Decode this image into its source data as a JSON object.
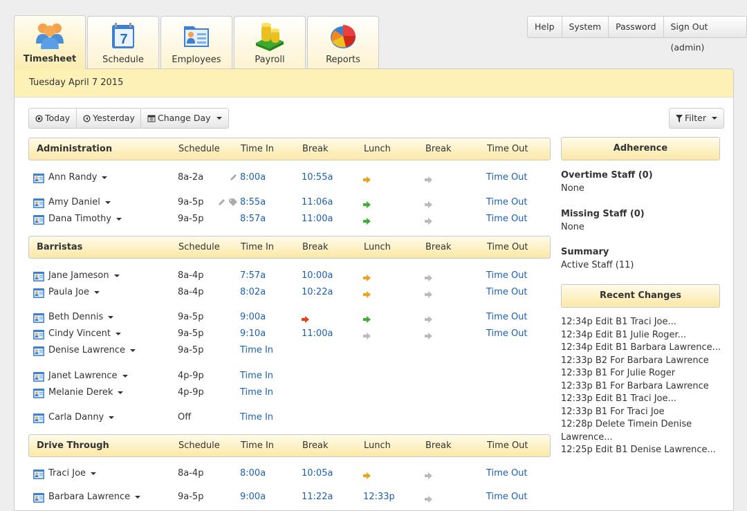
{
  "tabs": [
    {
      "label": "Timesheet",
      "icon": "people-icon",
      "active": true
    },
    {
      "label": "Schedule",
      "icon": "calendar-icon",
      "active": false
    },
    {
      "label": "Employees",
      "icon": "employee-card-icon",
      "active": false
    },
    {
      "label": "Payroll",
      "icon": "coins-icon",
      "active": false
    },
    {
      "label": "Reports",
      "icon": "pie-chart-icon",
      "active": false
    }
  ],
  "top_buttons": [
    "Help",
    "System",
    "Password",
    "Sign Out (admin)"
  ],
  "date": "Tuesday April 7 2015",
  "toolbar": {
    "today": "Today",
    "yesterday": "Yesterday",
    "change_day": "Change Day",
    "filter": "Filter"
  },
  "columns": {
    "schedule": "Schedule",
    "time_in": "Time In",
    "break1": "Break",
    "lunch": "Lunch",
    "break2": "Break",
    "time_out": "Time Out"
  },
  "groups": [
    {
      "name": "Administration",
      "employees": [
        {
          "name": "Ann Randy",
          "schedule": "8a-2a",
          "time_in": "8:00a",
          "edited": true,
          "tagged": false,
          "break1": "10:55a",
          "lunch": "arrow-orange",
          "break2": "arrow-gray",
          "time_out": "Time Out"
        },
        {
          "name": "Amy Daniel",
          "schedule": "9a-5p",
          "time_in": "8:55a",
          "edited": true,
          "tagged": true,
          "break1": "11:06a",
          "lunch": "arrow-green",
          "break2": "arrow-gray",
          "time_out": "Time Out"
        },
        {
          "name": "Dana Timothy",
          "schedule": "9a-5p",
          "time_in": "8:57a",
          "edited": false,
          "tagged": false,
          "break1": "11:00a",
          "lunch": "arrow-green",
          "break2": "arrow-gray",
          "time_out": "Time Out"
        }
      ]
    },
    {
      "name": "Barristas",
      "employees": [
        {
          "name": "Jane Jameson",
          "schedule": "8a-4p",
          "time_in": "7:57a",
          "break1": "10:00a",
          "lunch": "arrow-orange",
          "break2": "arrow-gray",
          "time_out": "Time Out"
        },
        {
          "name": "Paula Joe",
          "schedule": "8a-4p",
          "time_in": "8:02a",
          "break1": "10:22a",
          "lunch": "arrow-orange",
          "break2": "arrow-gray",
          "time_out": "Time Out"
        },
        {
          "name": "Beth Dennis",
          "schedule": "9a-5p",
          "time_in": "9:00a",
          "break1": "arrow-red",
          "lunch": "arrow-green",
          "break2": "arrow-gray",
          "time_out": "Time Out"
        },
        {
          "name": "Cindy Vincent",
          "schedule": "9a-5p",
          "time_in": "9:10a",
          "break1": "11:00a",
          "lunch": "arrow-gray",
          "break2": "arrow-gray",
          "time_out": "Time Out"
        },
        {
          "name": "Denise Lawrence",
          "schedule": "9a-5p",
          "time_in": "Time In"
        },
        {
          "name": "Janet Lawrence",
          "schedule": "4p-9p",
          "time_in": "Time In"
        },
        {
          "name": "Melanie Derek",
          "schedule": "4p-9p",
          "time_in": "Time In"
        },
        {
          "name": "Carla Danny",
          "schedule": "Off",
          "time_in": "Time In"
        }
      ]
    },
    {
      "name": "Drive Through",
      "employees": [
        {
          "name": "Traci Joe",
          "schedule": "8a-4p",
          "time_in": "8:00a",
          "break1": "10:05a",
          "lunch": "arrow-orange",
          "break2": "arrow-gray",
          "time_out": "Time Out"
        },
        {
          "name": "Barbara Lawrence",
          "schedule": "9a-5p",
          "time_in": "9:00a",
          "break1": "11:22a",
          "lunch": "12:33p",
          "break2": "arrow-gray",
          "time_out": "Time Out"
        }
      ]
    }
  ],
  "sidebar": {
    "adherence_title": "Adherence",
    "overtime_label": "Overtime Staff (0)",
    "overtime_value": "None",
    "missing_label": "Missing Staff (0)",
    "missing_value": "None",
    "summary_label": "Summary",
    "summary_value": "Active Staff (11)",
    "recent_title": "Recent Changes",
    "recent_changes": [
      "12:34p Edit B1 Traci Joe...",
      "12:34p Edit B1 Julie Roger...",
      "12:34p Edit B1 Barbara Lawrence...",
      "12:33p B2 For Barbara Lawrence",
      "12:33p B1 For Julie Roger",
      "12:33p B1 For Barbara Lawrence",
      "12:33p Edit B1 Traci Joe...",
      "12:33p B1 For Traci Joe",
      "12:28p Delete Timein Denise Lawrence...",
      "12:25p Edit B1 Denise Lawrence..."
    ]
  },
  "colors": {
    "link": "#1a5fb4",
    "header_yellow": "#fdf1b6",
    "arrow_orange": "#f0a020",
    "arrow_green": "#3cb030",
    "arrow_red": "#e84010",
    "arrow_gray": "#bbbbbb"
  }
}
